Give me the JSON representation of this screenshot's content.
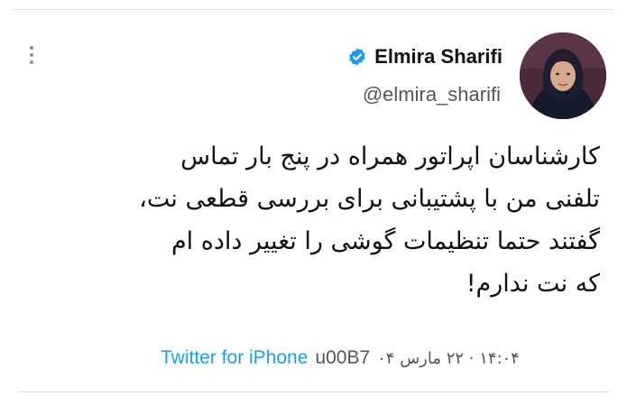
{
  "user": {
    "display_name": "Elmira Sharifi",
    "handle": "@elmira_sharifi",
    "verified": true
  },
  "tweet": {
    "lines": [
      "کارشناسان اپراتور همراه در پنج بار تماس",
      "تلفنی من با پشتیبانی برای بررسی قطعی نت،",
      "گفتند حتما تنظیمات گوشی را تغییر داده ام",
      "که نت ندارم!"
    ]
  },
  "meta": {
    "source": "Twitter for iPhone",
    "separator_glyph": "u00B7",
    "date": "۱۴:۰۴ · ۲۲ مارس ۰۴"
  },
  "colors": {
    "link": "#1d9bf0",
    "verified_badge": "#1d9bf0",
    "text": "#111111",
    "muted": "#555555"
  },
  "icons": {
    "more": "vertical-dots-icon",
    "verified": "verified-badge-icon"
  }
}
